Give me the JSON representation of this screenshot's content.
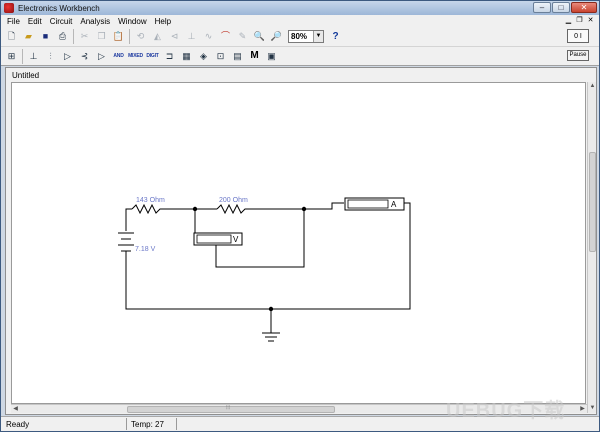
{
  "window": {
    "title": "Electronics Workbench"
  },
  "window_controls": {
    "minimize": "–",
    "maximize": "□",
    "close": "✕"
  },
  "menu": [
    {
      "label": "File",
      "key": "file"
    },
    {
      "label": "Edit",
      "key": "edit"
    },
    {
      "label": "Circuit",
      "key": "circuit"
    },
    {
      "label": "Analysis",
      "key": "analysis"
    },
    {
      "label": "Window",
      "key": "window"
    },
    {
      "label": "Help",
      "key": "help"
    }
  ],
  "toolbar": {
    "zoom_value": "80%",
    "help_label": "?",
    "m_label": "M",
    "pause_label": "Pause",
    "power_label": "0 I"
  },
  "parts_bins": {
    "bin1": "AND",
    "bin2": "MIXED",
    "bin3": "DIGIT"
  },
  "circuit": {
    "title": "Untitled",
    "r1_label": "143  Ohm",
    "r2_label": "200  Ohm",
    "battery_label": "7.18 V",
    "voltmeter_label": "V",
    "ammeter_label": "A"
  },
  "status": {
    "ready": "Ready",
    "temp": "Temp:  27"
  },
  "watermark": "UEBUG下载",
  "colors": {
    "accent": "#6d8fb7",
    "label_blue": "#6b78c8",
    "wire": "#000000"
  }
}
